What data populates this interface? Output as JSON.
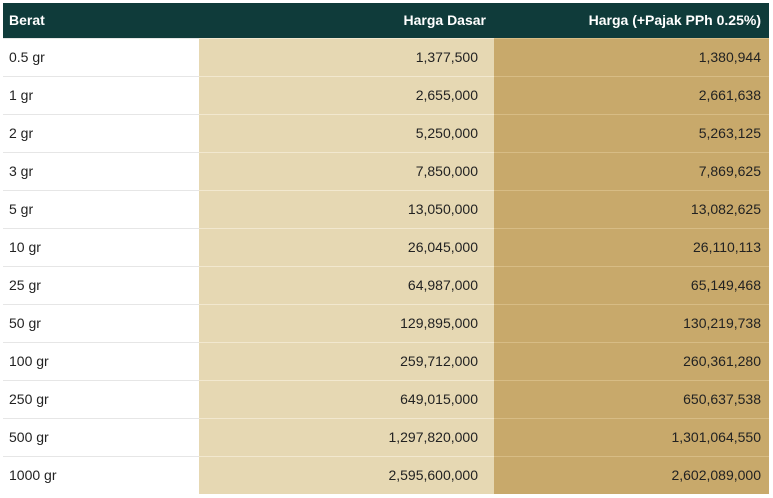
{
  "table": {
    "headers": [
      "Berat",
      "Harga Dasar",
      "Harga (+Pajak PPh 0.25%)"
    ],
    "rows": [
      [
        "0.5 gr",
        "1,377,500",
        "1,380,944"
      ],
      [
        "1 gr",
        "2,655,000",
        "2,661,638"
      ],
      [
        "2 gr",
        "5,250,000",
        "5,263,125"
      ],
      [
        "3 gr",
        "7,850,000",
        "7,869,625"
      ],
      [
        "5 gr",
        "13,050,000",
        "13,082,625"
      ],
      [
        "10 gr",
        "26,045,000",
        "26,110,113"
      ],
      [
        "25 gr",
        "64,987,000",
        "65,149,468"
      ],
      [
        "50 gr",
        "129,895,000",
        "130,219,738"
      ],
      [
        "100 gr",
        "259,712,000",
        "260,361,280"
      ],
      [
        "250 gr",
        "649,015,000",
        "650,637,538"
      ],
      [
        "500 gr",
        "1,297,820,000",
        "1,301,064,550"
      ],
      [
        "1000 gr",
        "2,595,600,000",
        "2,602,089,000"
      ]
    ]
  },
  "colors": {
    "header_bg": "#0f3b3a",
    "header_text": "#ffffff",
    "base_price_bg": "#e6d8b3",
    "tax_price_bg": "#c8a96b"
  }
}
